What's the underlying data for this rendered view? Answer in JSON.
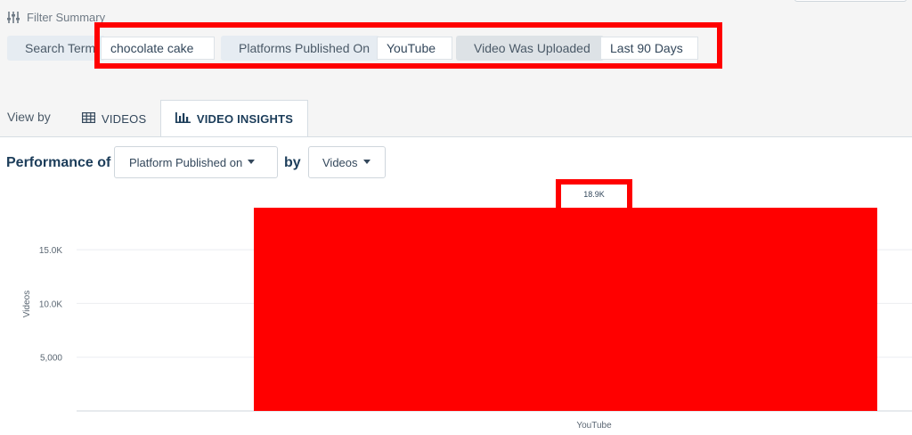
{
  "filter_summary": {
    "title": "Filter Summary",
    "icon": "sliders-icon",
    "filters": [
      {
        "label": "Search Term",
        "value": "chocolate cake"
      },
      {
        "label": "Platforms Published On",
        "value": "YouTube"
      },
      {
        "label": "Video Was Uploaded",
        "value": "Last 90 Days"
      }
    ]
  },
  "view_by": {
    "label": "View by",
    "tabs": [
      {
        "label": "VIDEOS",
        "icon": "table-icon",
        "active": false
      },
      {
        "label": "VIDEO INSIGHTS",
        "icon": "bar-chart-icon",
        "active": true
      }
    ]
  },
  "performance": {
    "prefix": "Performance of",
    "dimension": "Platform Published on",
    "by": "by",
    "metric": "Videos"
  },
  "colors": {
    "bar": "#ff0000",
    "highlight": "#ff0000",
    "heading": "#1c3d5a"
  },
  "chart_data": {
    "type": "bar",
    "categories": [
      "YouTube"
    ],
    "values": [
      18900
    ],
    "value_labels": [
      "18.9K"
    ],
    "ylabel": "Videos",
    "xlabel": "",
    "yticks": [
      {
        "value": 5000,
        "label": "5,000"
      },
      {
        "value": 10000,
        "label": "10.0K"
      },
      {
        "value": 15000,
        "label": "15.0K"
      }
    ],
    "ylim": [
      0,
      19000
    ],
    "grid": true,
    "legend": "none"
  }
}
